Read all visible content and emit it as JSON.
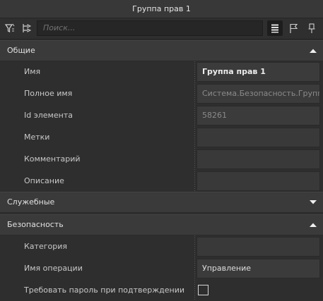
{
  "window": {
    "title": "Группа прав 1"
  },
  "toolbar": {
    "search_placeholder": "Поиск...",
    "buttons": [
      "filter-icon",
      "expand-collapse-icon",
      "list-view-icon",
      "flag-icon",
      "pin-icon"
    ]
  },
  "sections": {
    "general": {
      "label": "Общие",
      "expanded": true,
      "rows": [
        {
          "name": "Имя",
          "value": "Группа прав 1"
        },
        {
          "name": "Полное имя",
          "value": "Система.Безопасность.Группы"
        },
        {
          "name": "Id элемента",
          "value": "58261"
        },
        {
          "name": "Метки",
          "value": ""
        },
        {
          "name": "Комментарий",
          "value": ""
        },
        {
          "name": "Описание",
          "value": ""
        }
      ]
    },
    "service": {
      "label": "Служебные",
      "expanded": false
    },
    "security": {
      "label": "Безопасность",
      "expanded": true,
      "rows": [
        {
          "name": "Категория",
          "value": ""
        },
        {
          "name": "Имя операции",
          "value": "Управление"
        },
        {
          "name": "Требовать пароль при подтверждении",
          "checked": false
        }
      ]
    }
  },
  "colors": {
    "background": "#2e2e2e",
    "section": "#3a3a3a",
    "field": "#3b3b3b",
    "text": "#d0d0d0"
  }
}
